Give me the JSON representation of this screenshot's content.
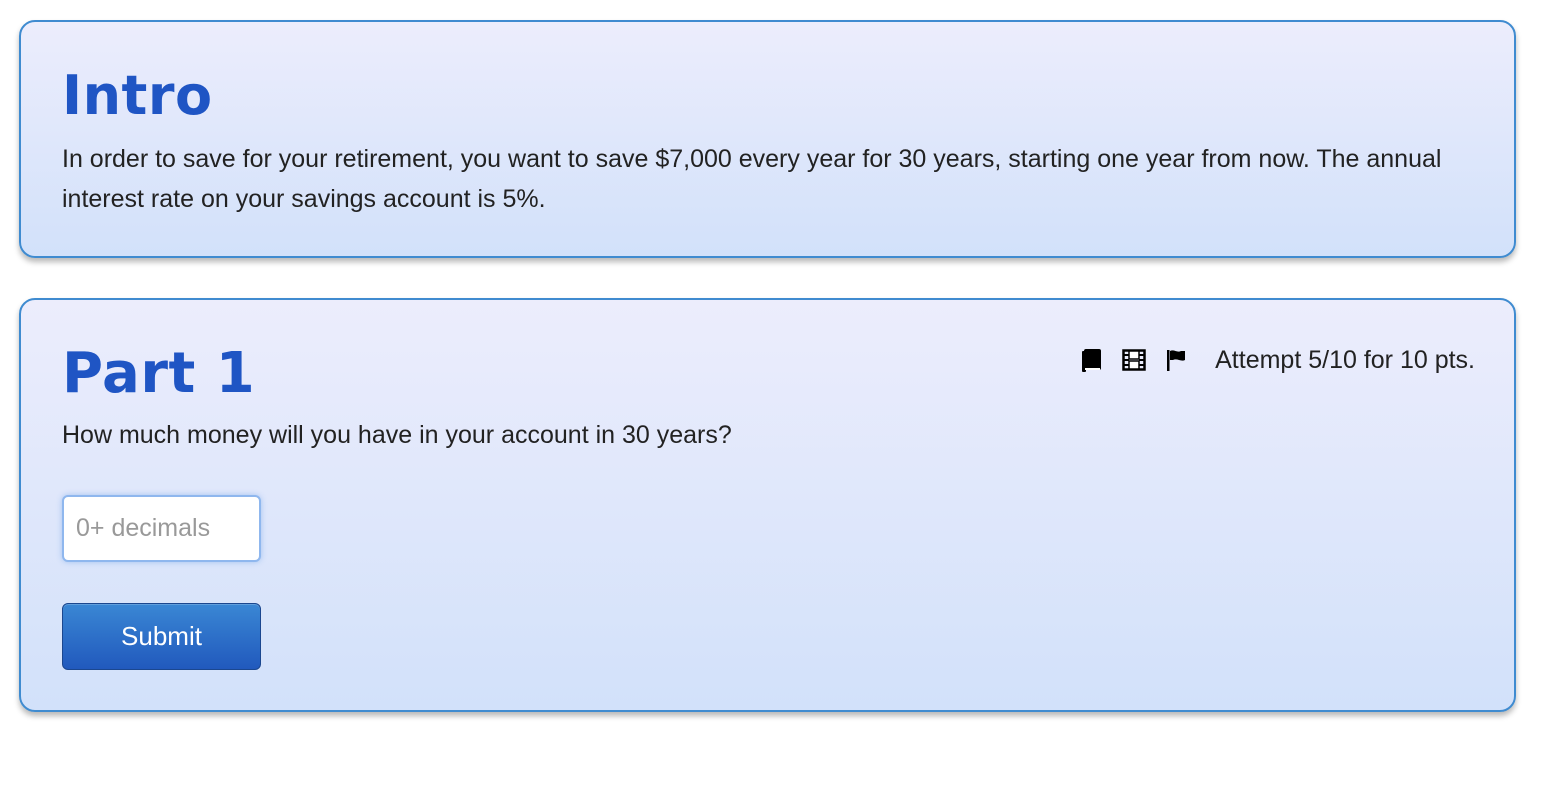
{
  "intro": {
    "title": "Intro",
    "text": "In order to save for your retirement, you want to save $7,000 every year for 30 years, starting one year from now. The annual interest rate on your savings account is 5%."
  },
  "part1": {
    "title": "Part 1",
    "toolbar": {
      "icons": [
        "book-icon",
        "film-icon",
        "flag-icon"
      ],
      "attempt": "Attempt 5/10 for 10 pts."
    },
    "question": "How much money will you have in your account in 30 years?",
    "answer": {
      "value": "",
      "placeholder": "0+ decimals"
    },
    "submit_label": "Submit"
  },
  "colors": {
    "title": "#1f55c4",
    "panel_border": "#3f8bd0",
    "panel_top": "#ecedfc",
    "panel_bottom": "#d2e1fa",
    "button_top": "#3a87d4",
    "button_bottom": "#2159bd"
  }
}
